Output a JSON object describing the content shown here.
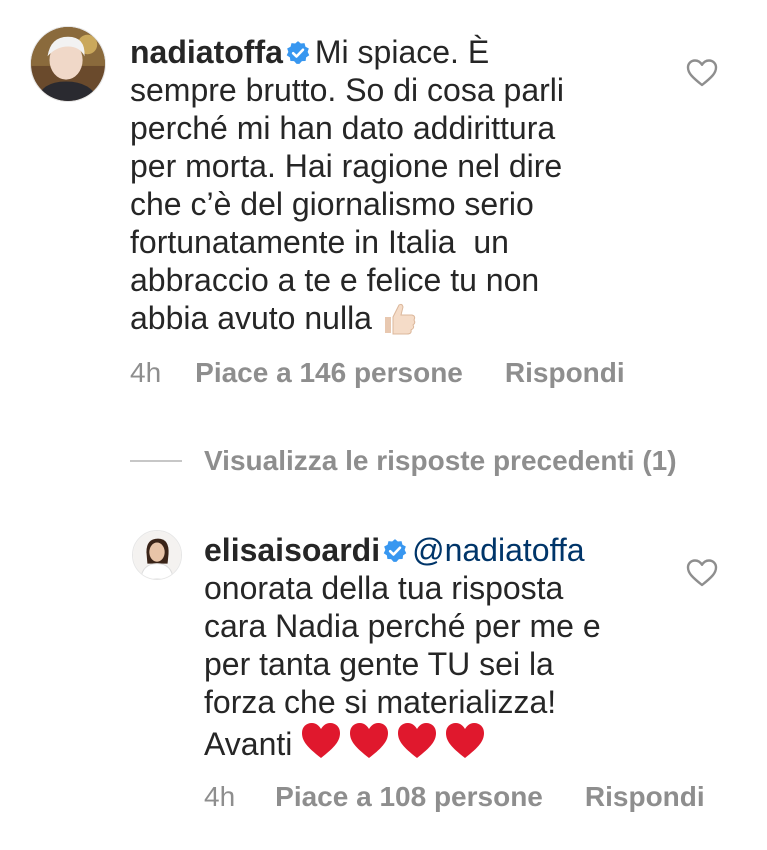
{
  "comments": [
    {
      "username": "nadiatoffa",
      "text": "Mi spiace. È\nsempre brutto. So di cosa parli\nperché mi han dato addirittura\nper morta. Hai ragione nel dire\nche c’è del giornalismo serio\nfortunatamente in Italia  un\nabbraccio a te e felice tu non\nabbia avuto nulla",
      "emoji": "thumbs-up",
      "time": "4h",
      "likes": "Piace a 146 persone",
      "reply": "Rispondi"
    },
    {
      "username": "elisaisoardi",
      "mention": "@nadiatoffa",
      "text": "\nonorata della tua risposta\ncara Nadia perché per me e\nper tanta gente TU sei la\nforza che si materializza!\nAvanti",
      "emoji": "red-hearts-x4",
      "time": "4h",
      "likes": "Piace a 108 persone",
      "reply": "Rispondi"
    }
  ],
  "view_replies": "Visualizza le risposte precedenti (1)",
  "colors": {
    "text": "#262626",
    "meta": "#8e8e8e",
    "verified": "#3897f0",
    "mention": "#003569",
    "heart_emoji": "#e0182d"
  }
}
